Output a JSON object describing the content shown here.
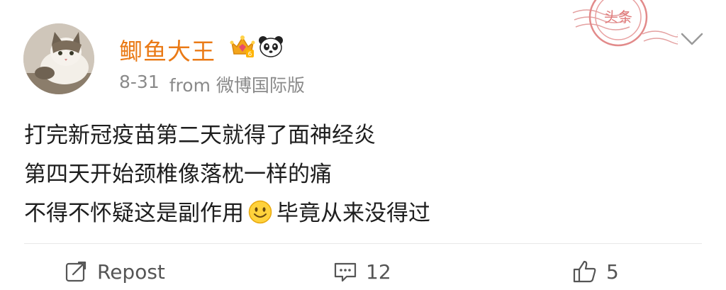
{
  "post": {
    "username": "鲫鱼大王",
    "date": "8-31",
    "source": "from 微博国际版",
    "content_lines": [
      "打完新冠疫苗第二天就得了面神经炎",
      "第四天开始颈椎像落枕一样的痛",
      {
        "before_emoji": "不得不怀疑这是副作用",
        "after_emoji": "毕竟从来没得过"
      }
    ],
    "stamp_text": "头条",
    "badges": [
      "crown-badge-icon",
      "panda-icon"
    ]
  },
  "actions": {
    "repost_label": "Repost",
    "comments_count": "12",
    "likes_count": "5"
  },
  "colors": {
    "username": "#ea7a16",
    "meta": "#8a8a8a",
    "stamp": "#d94b4b"
  }
}
